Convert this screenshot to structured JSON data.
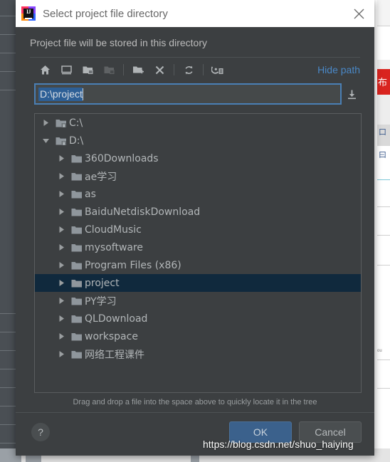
{
  "window": {
    "title": "Select project file directory",
    "logo_icon": "intellij-idea-logo",
    "close_icon": "close-icon",
    "subtitle": "Project file will be stored in this directory"
  },
  "toolbar": {
    "buttons": [
      {
        "name": "home-icon",
        "tooltip": "Home",
        "disabled": false
      },
      {
        "name": "desktop-icon",
        "tooltip": "Desktop",
        "disabled": false
      },
      {
        "name": "folder-up-icon",
        "tooltip": "Up",
        "disabled": false
      },
      {
        "name": "folder-icon",
        "tooltip": "Folder",
        "disabled": true
      },
      {
        "name": "new-folder-icon",
        "tooltip": "New Folder",
        "disabled": false
      },
      {
        "name": "delete-icon",
        "tooltip": "Delete",
        "disabled": false
      },
      {
        "name": "refresh-icon",
        "tooltip": "Refresh",
        "disabled": false
      },
      {
        "name": "show-hidden-files-icon",
        "tooltip": "Show Hidden Files",
        "disabled": false
      }
    ],
    "hide_path_label": "Hide path"
  },
  "path_field": {
    "value": "D:\\project",
    "selected": true,
    "download_icon": "download-arrow-icon"
  },
  "tree": {
    "items": [
      {
        "label": "C:\\",
        "level": 0,
        "expanded": false,
        "icon": "drive-locked-icon",
        "selected": false
      },
      {
        "label": "D:\\",
        "level": 0,
        "expanded": true,
        "icon": "drive-locked-icon",
        "selected": false
      },
      {
        "label": "360Downloads",
        "level": 1,
        "expanded": false,
        "icon": "folder-icon",
        "selected": false
      },
      {
        "label": "ae学习",
        "level": 1,
        "expanded": false,
        "icon": "folder-icon",
        "selected": false
      },
      {
        "label": "as",
        "level": 1,
        "expanded": false,
        "icon": "folder-icon",
        "selected": false
      },
      {
        "label": "BaiduNetdiskDownload",
        "level": 1,
        "expanded": false,
        "icon": "folder-icon",
        "selected": false
      },
      {
        "label": "CloudMusic",
        "level": 1,
        "expanded": false,
        "icon": "folder-icon",
        "selected": false
      },
      {
        "label": "mysoftware",
        "level": 1,
        "expanded": false,
        "icon": "folder-icon",
        "selected": false
      },
      {
        "label": "Program Files (x86)",
        "level": 1,
        "expanded": false,
        "icon": "folder-icon",
        "selected": false
      },
      {
        "label": "project",
        "level": 1,
        "expanded": false,
        "icon": "folder-icon",
        "selected": true
      },
      {
        "label": "PY学习",
        "level": 1,
        "expanded": false,
        "icon": "folder-icon",
        "selected": false
      },
      {
        "label": "QLDownload",
        "level": 1,
        "expanded": false,
        "icon": "folder-icon",
        "selected": false
      },
      {
        "label": "workspace",
        "level": 1,
        "expanded": false,
        "icon": "folder-icon",
        "selected": false
      },
      {
        "label": "网络工程课件",
        "level": 1,
        "expanded": false,
        "icon": "folder-icon",
        "selected": false
      }
    ]
  },
  "hint": "Drag and drop a file into the space above to quickly locate it in the tree",
  "footer": {
    "help_label": "?",
    "ok_label": "OK",
    "cancel_label": "Cancel"
  },
  "watermark": "https://blog.csdn.net/shuo_haiying",
  "background": {
    "red_badge_text": "布",
    "cn_1": "口",
    "cn_2": "曰",
    "small_text": "ou"
  },
  "colors": {
    "dialog_bg": "#3c3f41",
    "titlebar_bg": "#ffffff",
    "accent_blue": "#4a88c7",
    "selection_row": "#10293d",
    "ok_button": "#3b618c",
    "field_border": "#4a7fb5",
    "text_selection": "#2d5f96"
  }
}
